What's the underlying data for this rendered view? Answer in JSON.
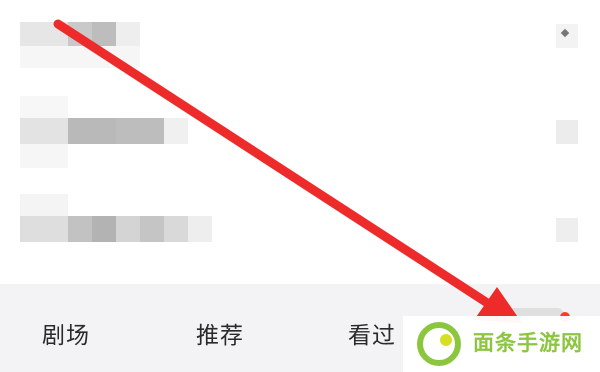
{
  "tabs": [
    {
      "label": "剧场"
    },
    {
      "label": "推荐"
    },
    {
      "label": "看过"
    }
  ],
  "watermark": {
    "text": "面条手游网"
  },
  "colors": {
    "arrow": "#ee2b2b",
    "accent_dot": "#ff3b1f",
    "tabbar_bg": "#f3f3f5",
    "watermark_text": "#8cc63f",
    "logo_green": "#8cc63f",
    "logo_yellow": "#d7df23"
  }
}
